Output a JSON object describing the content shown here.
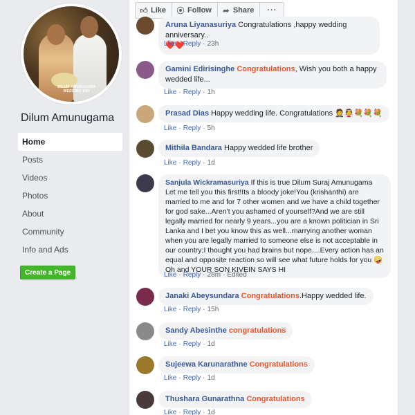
{
  "page": {
    "name": "Dilum Amunugama",
    "avatar_caption_line1": "DILUM AMUNUGAMA",
    "avatar_caption_line2": "WEDDING DAY"
  },
  "nav": {
    "items": [
      "Home",
      "Posts",
      "Videos",
      "Photos",
      "About",
      "Community",
      "Info and Ads"
    ],
    "active": "Home"
  },
  "create_page_label": "Create a Page",
  "actions": {
    "like": "Like",
    "follow": "Follow",
    "share": "Share",
    "more": "···"
  },
  "comment_actions": {
    "like": "Like",
    "reply": "Reply",
    "edited": "Edited"
  },
  "comments": [
    {
      "author": "Aruna Liyanasuriya",
      "highlight": "",
      "text": "Congratulations ,happy wedding anniversary..",
      "emoji": "❤️❤️",
      "time": "23h",
      "avatar_color": "#6b4a2e"
    },
    {
      "author": "Gamini Edirisinghe",
      "highlight": "Congratulations",
      "text": ", Wish you both a happy wedded life...",
      "emoji": "",
      "time": "1h",
      "avatar_color": "#8a5a8a"
    },
    {
      "author": "Prasad Dias",
      "highlight": "",
      "text": "Happy wedding life. Congratulations",
      "emoji": "🤵👰💐💐💐",
      "time": "5h",
      "avatar_color": "#c9a77a"
    },
    {
      "author": "Mithila Bandara",
      "highlight": "",
      "text": "Happy wedded life brother",
      "emoji": "",
      "time": "1d",
      "avatar_color": "#5a4a30"
    },
    {
      "author": "Sanjula Wickramasuriya",
      "highlight": "",
      "text": "If this is true Dilum Suraj Amunugama Let me tell you this first!Its a bloody joke!You (krishanthi) are married to me and for 7 other women and we have a child together for god sake...Aren't you ashamed of yourself?And we are still legally married for nearly 9 years...you are a known politician in Sri Lanka and I bet you know this as well...marrying another woman when you are legally married to someone else is not acceptable in our country;I thought you had brains but nope....Every action has an equal and opposite reaction so will see what future holds for you",
      "emoji_end": "🤪",
      "text2": "Oh and YOUR SON KIVEIN SAYS HI",
      "time": "28m",
      "edited": true,
      "avatar_color": "#3a3a4a"
    },
    {
      "author": "Janaki Abeysundara",
      "highlight": "Congratulations",
      "text": ".Happy wedded life.",
      "emoji": "",
      "time": "15h",
      "avatar_color": "#7a2a4a"
    },
    {
      "author": "Sandy Abesinthe",
      "highlight": "congratulations",
      "text": "",
      "emoji": "",
      "time": "1d",
      "avatar_color": "#8a8a8a"
    },
    {
      "author": "Sujeewa Karunarathne",
      "highlight": "Congratulations",
      "text": "",
      "emoji": "",
      "time": "1d",
      "avatar_color": "#9a7a2a"
    },
    {
      "author": "Thushara Gunarathna",
      "highlight": "Congratulations",
      "text": "",
      "emoji": "",
      "time": "1d",
      "avatar_color": "#4a3a3a"
    }
  ]
}
